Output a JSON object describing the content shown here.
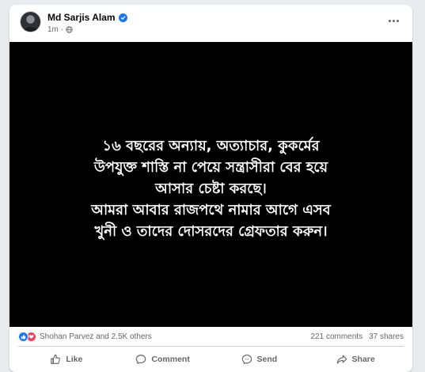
{
  "post": {
    "author": "Md Sarjis Alam",
    "time": "1m",
    "image_text_lines": [
      "১৬ বছরের অন্যায়, অত্যাচার, কুকর্মের",
      "উপযুক্ত শাস্তি না পেয়ে সন্ত্রাসীরা বের হয়ে",
      "আসার চেষ্টা করছে।",
      "আমরা আবার রাজপথে নামার আগে এসব",
      "খুনী ও তাদের দোসরদের গ্রেফতার করুন।"
    ]
  },
  "stats": {
    "reactions_text": "Shohan Parvez and 2.5K others",
    "comments": "221 comments",
    "shares": "37 shares"
  },
  "actions": {
    "like": "Like",
    "comment": "Comment",
    "send": "Send",
    "share": "Share"
  },
  "colors": {
    "accent": "#1877f2",
    "love": "#f33e58",
    "secondary_text": "#65676b",
    "image_bg": "#000000"
  },
  "icons": [
    "avatar",
    "verified-badge-icon",
    "globe-icon",
    "more-options-icon",
    "like-reaction-icon",
    "love-reaction-icon",
    "like-icon",
    "comment-icon",
    "send-icon",
    "share-icon"
  ]
}
